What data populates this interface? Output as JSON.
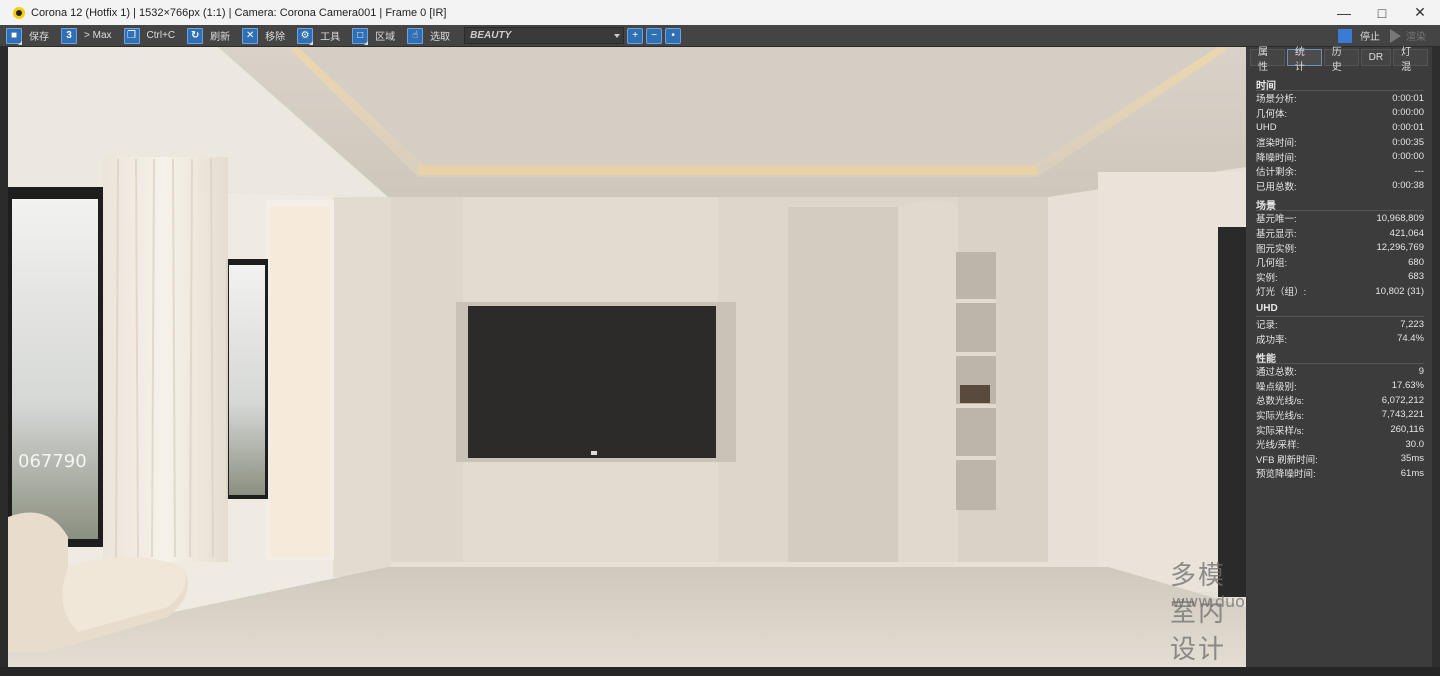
{
  "window": {
    "title": "Corona 12 (Hotfix 1) | 1532×766px (1:1) | Camera: Corona Camera001 | Frame 0 [IR]",
    "min_icon": "minimize-icon",
    "max_icon": "maximize-icon",
    "close_icon": "close-icon"
  },
  "toolbar": {
    "save": "保存",
    "to_max": "> Max",
    "copy": "Ctrl+C",
    "refresh": "刷新",
    "remove": "移除",
    "tools": "工具",
    "region": "区域",
    "pick": "选取",
    "channel": "BEAUTY",
    "stop": "停止",
    "render": "渲染"
  },
  "tabs": [
    "属性",
    "统计",
    "历史",
    "DR",
    "灯混"
  ],
  "active_tab": "统计",
  "stats": {
    "time": {
      "title": "时间",
      "rows": [
        [
          "场景分析:",
          "0:00:01"
        ],
        [
          "几何体:",
          "0:00:00"
        ],
        [
          "UHD",
          "0:00:01"
        ],
        [
          "渲染时间:",
          "0:00:35"
        ],
        [
          "降噪时间:",
          "0:00:00"
        ],
        [
          "估计剩余:",
          "---"
        ],
        [
          "已用总数:",
          "0:00:38"
        ]
      ]
    },
    "scene": {
      "title": "场景",
      "rows": [
        [
          "基元唯一:",
          "10,968,809"
        ],
        [
          "基元显示:",
          "421,064"
        ],
        [
          "图元实例:",
          "12,296,769"
        ],
        [
          "几何组:",
          "680"
        ],
        [
          "实例:",
          "683"
        ],
        [
          "灯光（组）:",
          "10,802 (31)"
        ]
      ]
    },
    "uhd": {
      "title": "UHD",
      "rows": [
        [
          "记录:",
          "7,223"
        ],
        [
          "成功率:",
          "74.4%"
        ]
      ]
    },
    "perf": {
      "title": "性能",
      "rows": [
        [
          "通过总数:",
          "9"
        ],
        [
          "噪点级别:",
          "17.63%"
        ],
        [
          "总数光线/s:",
          "6,072,212"
        ],
        [
          "实际光线/s:",
          "7,743,221"
        ],
        [
          "实际采样/s:",
          "260,116"
        ],
        [
          "光线/采样:",
          "30.0"
        ],
        [
          "VFB 刷新时间:",
          "35ms"
        ],
        [
          "预览降噪时间:",
          "61ms"
        ]
      ]
    }
  },
  "viewport": {
    "frame_counter": "067790",
    "watermark_cn": "多模室内设计网",
    "watermark_url": "www.duomowang.com"
  }
}
